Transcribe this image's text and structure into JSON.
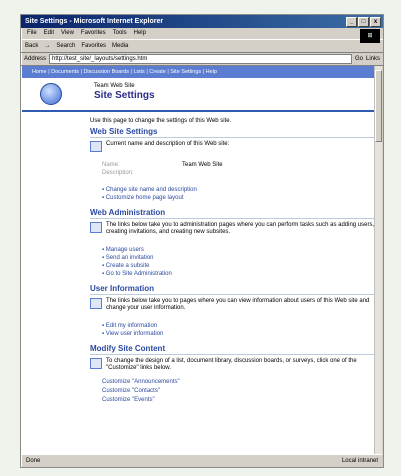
{
  "window": {
    "title": "Site Settings - Microsoft Internet Explorer",
    "controls": [
      "_",
      "□",
      "x"
    ]
  },
  "menu": [
    "File",
    "Edit",
    "View",
    "Favorites",
    "Tools",
    "Help"
  ],
  "toolbar": {
    "back": "Back",
    "forward": "→",
    "search": "Search",
    "favorites": "Favorites",
    "media": "Media"
  },
  "address": {
    "label": "Address",
    "url": "http://test_site/_layouts/settings.htm",
    "go": "Go",
    "links": "Links"
  },
  "sharepoint": {
    "nav_links": "Home | Documents | Discussion Boards | Lists | Create | Site Settings | Help",
    "site_name": "Team Web Site",
    "page_title": "Site Settings",
    "intro": "Use this page to change the settings of this Web site."
  },
  "sections": {
    "web_site_settings": {
      "heading": "Web Site Settings",
      "desc": "Current name and description of this Web site:",
      "name_label": "Name:",
      "name_value": "Team Web Site",
      "description_label": "Description:",
      "links": [
        "Change site name and description",
        "Customize home page layout"
      ]
    },
    "web_admin": {
      "heading": "Web Administration",
      "desc": "The links below take you to administration pages where you can perform tasks such as adding users, creating invitations, and creating new subsites.",
      "links": [
        "Manage users",
        "Send an invitation",
        "Create a subsite",
        "Go to Site Administration"
      ]
    },
    "user_info": {
      "heading": "User Information",
      "desc": "The links below take you to pages where you can view information about users of this Web site and change your user information.",
      "links": [
        "Edit my information",
        "View user information"
      ]
    },
    "modify_content": {
      "heading": "Modify Site Content",
      "desc": "To change the design of a list, document library, discussion boards, or surveys, click one of the \"Customize\" links below.",
      "links": [
        "Customize \"Announcements\"",
        "Customize \"Contacts\"",
        "Customize \"Events\""
      ]
    }
  },
  "status": {
    "left": "Done",
    "right": "Local intranet"
  }
}
